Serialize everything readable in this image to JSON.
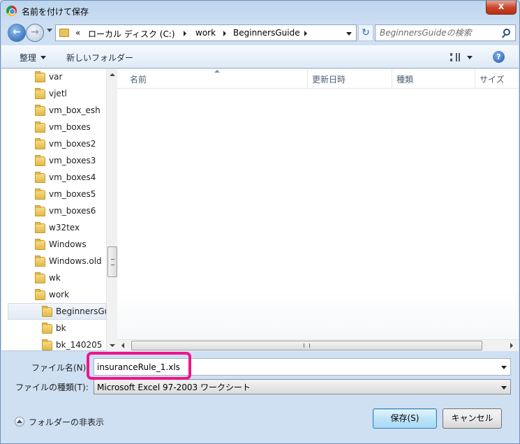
{
  "window": {
    "title": "名前を付けて保存",
    "close_label": "x"
  },
  "nav": {
    "back_icon": "back-arrow-icon",
    "forward_icon": "forward-arrow-icon",
    "breadcrumb_overflow": "«",
    "breadcrumb": [
      "ローカル ディスク (C:)",
      "work",
      "BeginnersGuide"
    ],
    "refresh_glyph": "↻",
    "search_placeholder": "BeginnersGuideの検索"
  },
  "toolbar": {
    "organize": "整理",
    "new_folder": "新しいフォルダー",
    "help": "?"
  },
  "tree": {
    "items": [
      {
        "label": "var",
        "indent": 1
      },
      {
        "label": "vjetl",
        "indent": 1
      },
      {
        "label": "vm_box_esh",
        "indent": 1
      },
      {
        "label": "vm_boxes",
        "indent": 1
      },
      {
        "label": "vm_boxes2",
        "indent": 1
      },
      {
        "label": "vm_boxes3",
        "indent": 1
      },
      {
        "label": "vm_boxes4",
        "indent": 1
      },
      {
        "label": "vm_boxes5",
        "indent": 1
      },
      {
        "label": "vm_boxes6",
        "indent": 1
      },
      {
        "label": "w32tex",
        "indent": 1
      },
      {
        "label": "Windows",
        "indent": 1
      },
      {
        "label": "Windows.old",
        "indent": 1
      },
      {
        "label": "wk",
        "indent": 1
      },
      {
        "label": "work",
        "indent": 1
      },
      {
        "label": "BeginnersGuide",
        "indent": 2,
        "selected": true
      },
      {
        "label": "bk",
        "indent": 2
      },
      {
        "label": "bk_140205",
        "indent": 2
      }
    ]
  },
  "file_list": {
    "columns": [
      "名前",
      "更新日時",
      "種類",
      "サイズ"
    ],
    "rows": []
  },
  "form": {
    "filename_label": "ファイル名(N):",
    "filename_value": "insuranceRule_1.xls",
    "filetype_label": "ファイルの種類(T):",
    "filetype_value": "Microsoft Excel 97-2003 ワークシート"
  },
  "footer": {
    "hide_folders": "フォルダーの非表示",
    "save": "保存(S)",
    "cancel": "キャンセル"
  },
  "colors": {
    "highlight": "#f0148c",
    "primary_button": "#bfe4f9"
  }
}
